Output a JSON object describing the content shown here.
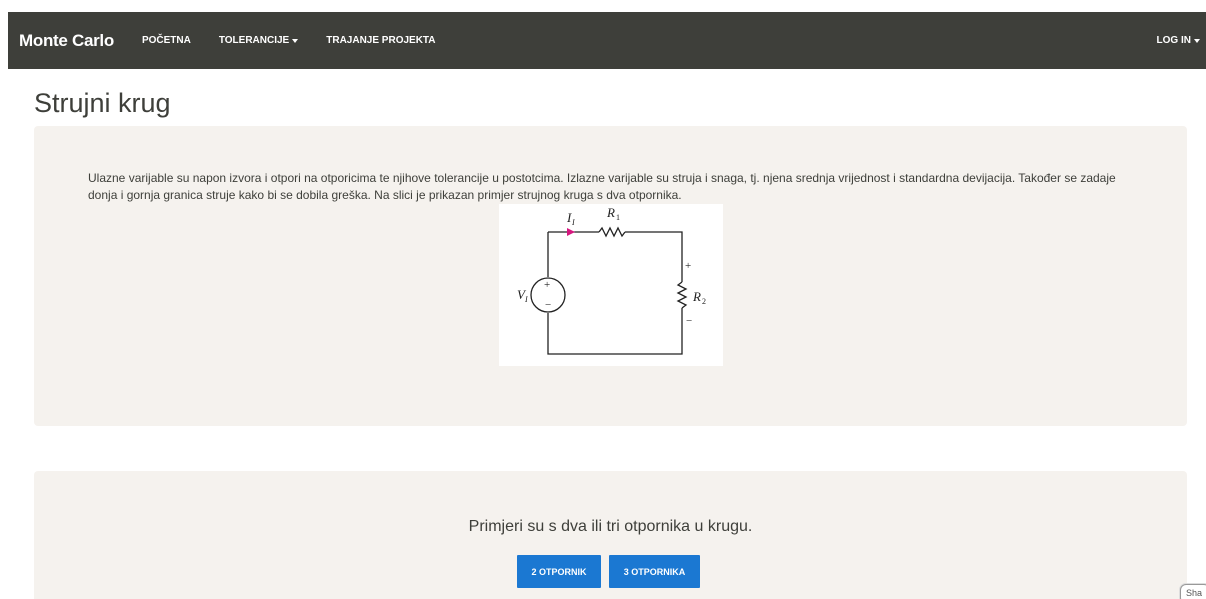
{
  "navbar": {
    "brand": "Monte Carlo",
    "links": [
      {
        "label": "POČETNA"
      },
      {
        "label": "TOLERANCIJE"
      },
      {
        "label": "TRAJANJE PROJEKTA"
      }
    ],
    "right": {
      "label": "LOG IN"
    }
  },
  "page": {
    "title": "Strujni krug"
  },
  "panel1": {
    "description": "Ulazne varijable su napon izvora i otpori na otporicima te njihove tolerancije u postotcima. Izlazne varijable su struja i snaga, tj. njena srednja vrijednost i standardna devijacija. Također se zadaje donja i gornja granica struje kako bi se dobila greška. Na slici je prikazan primjer strujnog kruga s dva otpornika.",
    "circuit": {
      "current_label": "I",
      "current_sub": "I",
      "r1_label": "R",
      "r1_sub": "1",
      "r2_label": "R",
      "r2_sub": "2",
      "v_label": "V",
      "v_sub": "I",
      "plus": "+",
      "minus": "−",
      "src_plus": "+",
      "src_minus": "−"
    }
  },
  "panel2": {
    "text": "Primjeri su s dva ili tri otpornika u krugu.",
    "button_2": "2 OTPORNIK",
    "button_3": "3 OTPORNIKA"
  },
  "share": {
    "label": "Sha"
  },
  "colors": {
    "navbar": "#3e3f3a",
    "panel": "#f5f2ee",
    "button": "#1b78d2",
    "arrow": "#d6177f"
  }
}
